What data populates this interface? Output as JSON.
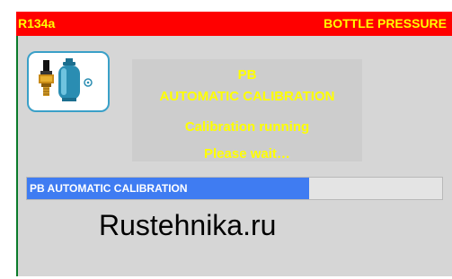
{
  "header": {
    "refrigerant": "R134a",
    "screen_title": "BOTTLE PRESSURE"
  },
  "icons": {
    "sensor": "pressure-sensor-icon",
    "bottle": "gas-bottle-icon"
  },
  "message": {
    "line1": "PB",
    "line2": "AUTOMATIC CALIBRATION",
    "line3": "Calibration running",
    "line4": "Please wait…"
  },
  "progress": {
    "label": "PB AUTOMATIC CALIBRATION",
    "fraction": 0.68
  },
  "watermark": "Rustehnika.ru",
  "colors": {
    "header_bg": "#ff0000",
    "header_text": "#ffff00",
    "message_text": "#ffff00",
    "progress_fill": "#3f7cf2",
    "panel_bg": "#d6d6d6"
  }
}
